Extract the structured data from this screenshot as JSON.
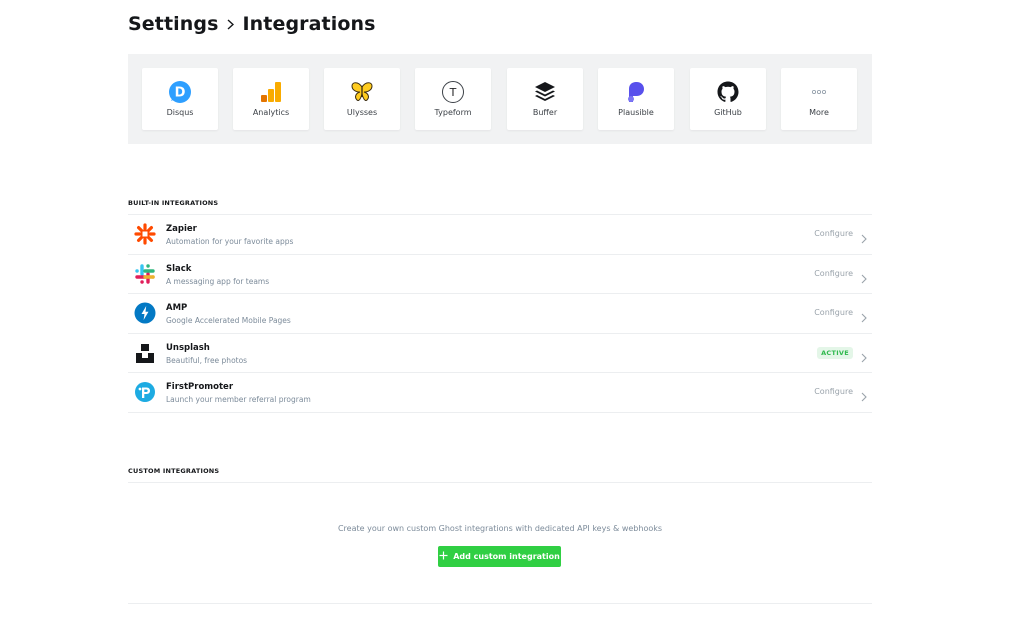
{
  "breadcrumb": {
    "parent": "Settings",
    "current": "Integrations"
  },
  "directory": [
    {
      "label": "Disqus",
      "icon": "disqus-icon"
    },
    {
      "label": "Analytics",
      "icon": "analytics-icon"
    },
    {
      "label": "Ulysses",
      "icon": "ulysses-icon"
    },
    {
      "label": "Typeform",
      "icon": "typeform-icon"
    },
    {
      "label": "Buffer",
      "icon": "buffer-icon"
    },
    {
      "label": "Plausible",
      "icon": "plausible-icon"
    },
    {
      "label": "GitHub",
      "icon": "github-icon"
    },
    {
      "label": "More",
      "icon": "more-icon"
    }
  ],
  "builtin": {
    "heading": "BUILT-IN INTEGRATIONS",
    "items": [
      {
        "title": "Zapier",
        "desc": "Automation for your favorite apps",
        "action": "Configure",
        "icon": "zapier-icon"
      },
      {
        "title": "Slack",
        "desc": "A messaging app for teams",
        "action": "Configure",
        "icon": "slack-icon"
      },
      {
        "title": "AMP",
        "desc": "Google Accelerated Mobile Pages",
        "action": "Configure",
        "icon": "amp-icon"
      },
      {
        "title": "Unsplash",
        "desc": "Beautiful, free photos",
        "action": "ACTIVE",
        "icon": "unsplash-icon"
      },
      {
        "title": "FirstPromoter",
        "desc": "Launch your member referral program",
        "action": "Configure",
        "icon": "firstpromoter-icon"
      }
    ]
  },
  "custom": {
    "heading": "CUSTOM INTEGRATIONS",
    "empty_text": "Create your own custom Ghost integrations with dedicated API keys & webhooks",
    "add_label": "Add custom integration"
  },
  "colors": {
    "accent": "#30cf43",
    "active_badge": "#30b94e",
    "text": "#15171a",
    "muted": "#7c8b9a"
  }
}
